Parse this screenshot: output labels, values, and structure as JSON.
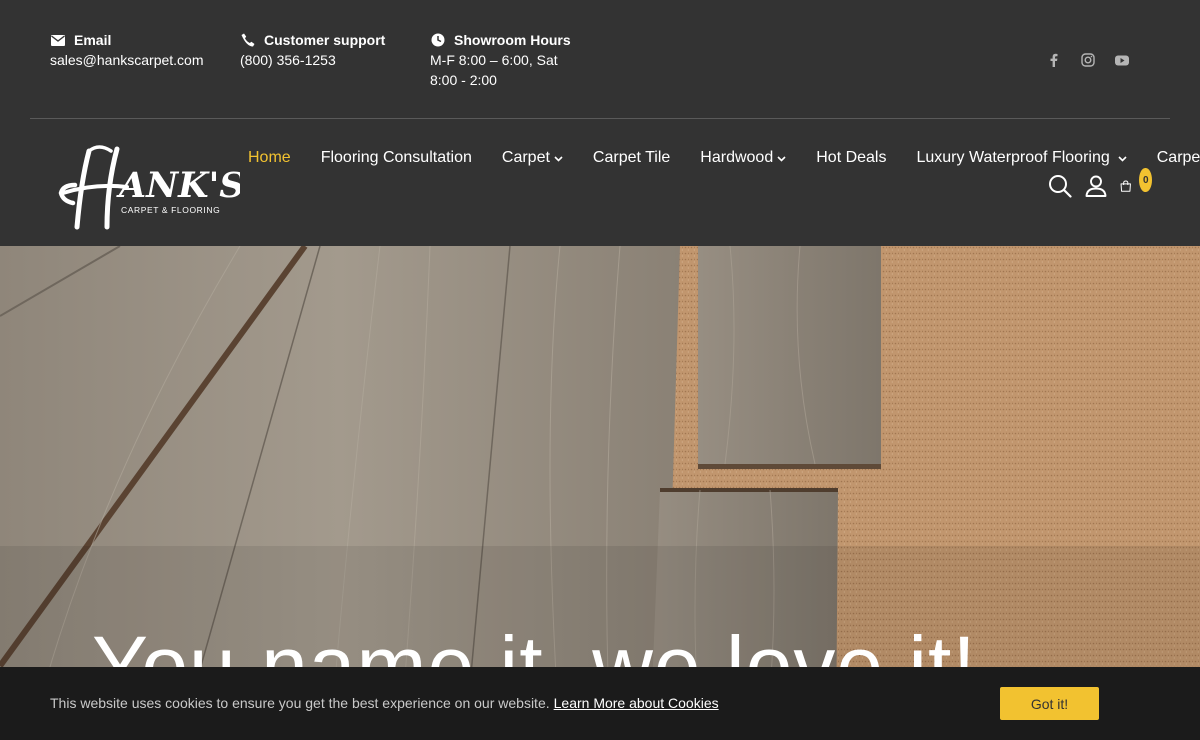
{
  "topbar": {
    "email": {
      "label": "Email",
      "value": "sales@hankscarpet.com",
      "icon": "envelope-icon"
    },
    "support": {
      "label": "Customer support",
      "value": "(800) 356-1253",
      "icon": "phone-icon"
    },
    "hours": {
      "label": "Showroom Hours",
      "value": "M-F 8:00 – 6:00, Sat 8:00 - 2:00",
      "icon": "clock-icon"
    },
    "social": [
      "facebook-icon",
      "instagram-icon",
      "youtube-icon"
    ]
  },
  "logo": {
    "main": "Hank's",
    "sub": "CARPET & FLOORING"
  },
  "nav": {
    "items": [
      {
        "label": "Home",
        "active": true,
        "dropdown": false
      },
      {
        "label": "Flooring Consultation",
        "active": false,
        "dropdown": false
      },
      {
        "label": "Carpet",
        "active": false,
        "dropdown": true
      },
      {
        "label": "Carpet Tile",
        "active": false,
        "dropdown": false
      },
      {
        "label": "Hardwood",
        "active": false,
        "dropdown": true
      },
      {
        "label": "Hot Deals",
        "active": false,
        "dropdown": false
      },
      {
        "label": "Luxury Waterproof Flooring",
        "active": false,
        "dropdown": true
      },
      {
        "label": "Carpet",
        "active": false,
        "dropdown": false
      }
    ],
    "cart_count": "0"
  },
  "hero": {
    "title": "You name it, we love it!"
  },
  "cookie": {
    "text": "This website uses cookies to ensure you get the best experience on our website.",
    "link": "Learn More about Cookies",
    "button": "Got it!"
  },
  "colors": {
    "accent": "#f2c230",
    "dark": "#333333",
    "cookie_bg": "#1b1b1b"
  }
}
